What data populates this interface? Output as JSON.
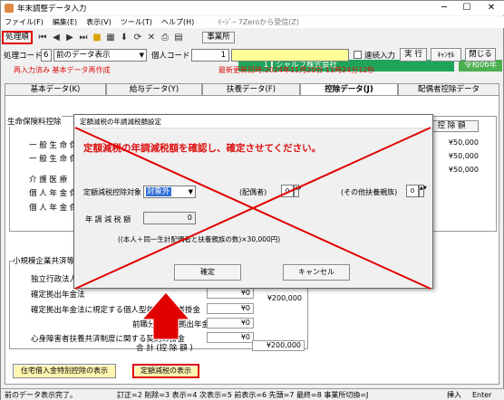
{
  "window": {
    "title": "年末調整データ入力",
    "minimize": "─",
    "maximize": "☐",
    "close": "✕"
  },
  "menu": {
    "items": [
      "ファイル(F)",
      "編集(E)",
      "表示(V)",
      "ツール(T)",
      "ヘルプ(H)"
    ],
    "extra": "ｲｰｼﾞｰ 7Zeroから受信(Z)"
  },
  "toolbar": {
    "order_button": "処理順",
    "office_label": "事業所",
    "office_number": "1",
    "office_name": "シャルフ株式会社",
    "year": "令和06年"
  },
  "row2": {
    "process_code_label": "処理コード",
    "process_code_value": "6",
    "process_select": "前のデータ表示",
    "personal_code_label": "個人コード",
    "personal_code_value": "1",
    "continuous_label": "連続入力",
    "execute_button": "実 行",
    "cancel_button": "ｷｬﾝｾﾙ",
    "close_button": "閉じる"
  },
  "info": {
    "status_left": "再入力済み  基本データ再作成",
    "updated": "最新更新日時:2024年11月20日 11時24分12秒"
  },
  "tabs": [
    "基本データ(K)",
    "給与データ(Y)",
    "扶養データ(F)",
    "控除データ(J)",
    "配偶者控除データ"
  ],
  "panel": {
    "life_insurance_title": "生命保険料控除",
    "amount_header": "控 除 額",
    "life_rows": [
      "一 般 生 命 保",
      "一 般 生 命 保",
      "介 護 医 療",
      "個 人 年 金 保",
      "個 人 年 金 保"
    ],
    "life_values": [
      "¥50,000",
      "¥50,000",
      "¥50,000"
    ],
    "small_title": "小規模企業共済等掛",
    "small_rows": [
      "独立行政法人",
      "確定拠出年金法",
      "確定拠出年金法に規定する個人型年金加入者掛金",
      "前職分の確定拠出年金",
      "心身障害者扶養共済制度に関する契約の掛金"
    ],
    "small_values": [
      "¥0",
      "¥0",
      "¥0",
      "¥0"
    ],
    "small_total": "¥200,000",
    "total_label": "合 計 (控 除 額 )",
    "total_value": "¥200,000",
    "housing_button": "住宅借入金特別控除の表示",
    "fixed_tax_button": "定額減税の表示"
  },
  "status": {
    "left": "前のデータ表示完了。",
    "keys": "訂正=2 削除=3 表示=4 次表示=5 前表示=6 先頭=7 最終=8 事業所切換=J",
    "insert": "挿入",
    "enter": "Enter"
  },
  "dialog": {
    "title": "定額減税の年調減税額設定",
    "message": "定額減税の年調減税額を確認し、確定させてください。",
    "target_label": "定額減税控除対象",
    "target_value": "対象外",
    "spouse_label": "(配偶者)",
    "spouse_value": "0",
    "other_label": "(その他扶養親族)",
    "other_value": "0",
    "amount_label": "年 調 減 税 額",
    "amount_value": "0",
    "formula": "((本人＋同一生計配偶者と扶養親族の数)×30,000円)",
    "confirm_button": "確定",
    "cancel_button": "キャンセル"
  },
  "colors": {
    "green": "#1fa55a",
    "red_annotation": "#e00000",
    "red_message": "#dd1111",
    "yellow": "#ffff99"
  }
}
